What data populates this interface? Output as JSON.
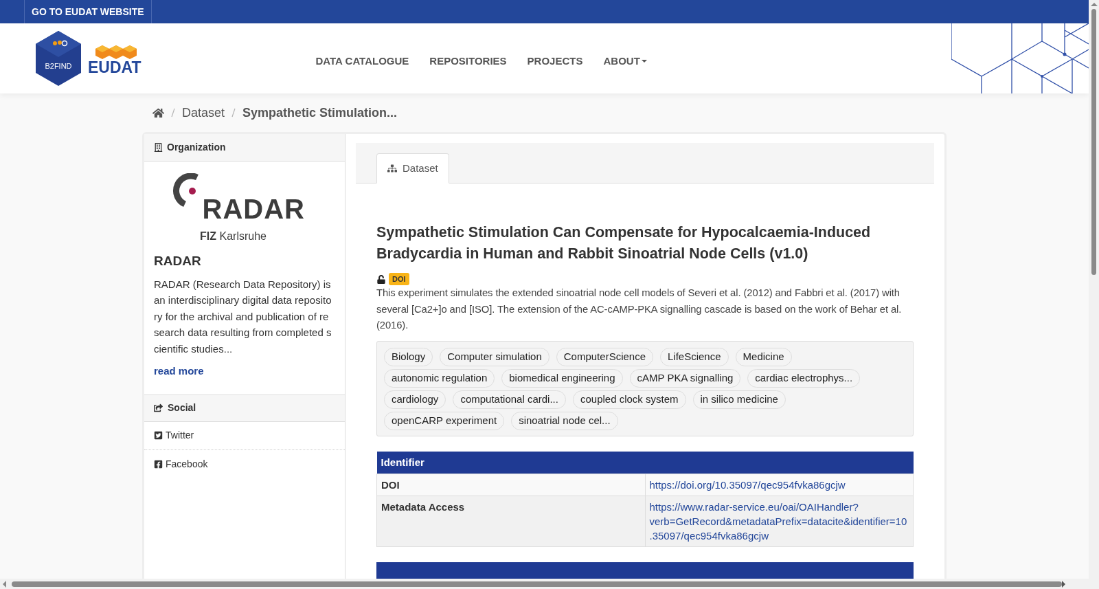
{
  "top_bar": {
    "link": "GO TO EUDAT WEBSITE"
  },
  "header": {
    "logo": {
      "badge": "B2FIND",
      "name": "EUDAT"
    },
    "nav": [
      {
        "label": "DATA CATALOGUE",
        "dropdown": false
      },
      {
        "label": "REPOSITORIES",
        "dropdown": false
      },
      {
        "label": "PROJECTS",
        "dropdown": false
      },
      {
        "label": "ABOUT",
        "dropdown": true
      }
    ]
  },
  "breadcrumb": [
    "Dataset",
    "Sympathetic Stimulation..."
  ],
  "organization": {
    "heading": "Organization",
    "logo": {
      "name": "RADAR",
      "sub_bold": "FIZ",
      "sub": "Karlsruhe"
    },
    "name": "RADAR",
    "description": "RADAR (Research Data Repository) is an interdisciplinary digital data repository for the archival and publication of research data resulting from completed scientific studies...",
    "read_more": "read more"
  },
  "social": {
    "heading": "Social",
    "links": [
      {
        "kind": "twitter",
        "label": "Twitter"
      },
      {
        "kind": "facebook",
        "label": "Facebook"
      }
    ]
  },
  "tabs": [
    {
      "label": "Dataset",
      "selected": true
    }
  ],
  "dataset": {
    "title": "Sympathetic Stimulation Can Compensate for Hypocalcaemia-Induced Bradycardia in Human and Rabbit Sinoatrial Node Cells (v1.0)",
    "open_access": true,
    "badge": "DOI",
    "description": "This experiment simulates the extended sinoatrial node cell models of Severi et al. (2012) and Fabbri et al. (2017) with several [Ca2+]o and [ISO]. The extension of the AC-cAMP-PKA signalling cascade is based on the work of Behar et al. (2016).",
    "tags": [
      "Biology",
      "Computer simulation",
      "ComputerScience",
      "LifeScience",
      "Medicine",
      "autonomic regulation",
      "biomedical engineering",
      "cAMP PKA signalling",
      "cardiac electrophys...",
      "cardiology",
      "computational cardi...",
      "coupled clock system",
      "in silico medicine",
      "openCARP experiment",
      "sinoatrial node cel..."
    ]
  },
  "tables": [
    {
      "heading": "Identifier",
      "rows": [
        {
          "label": "DOI",
          "value": "https://doi.org/10.35097/qec954fvka86gcjw"
        },
        {
          "label": "Metadata Access",
          "value": "https://www.radar-service.eu/oai/OAIHandler?verb=GetRecord&metadataPrefix=datacite&identifier=10.35097/qec954fvka86gcjw"
        }
      ]
    },
    {
      "cut_off": true
    }
  ]
}
